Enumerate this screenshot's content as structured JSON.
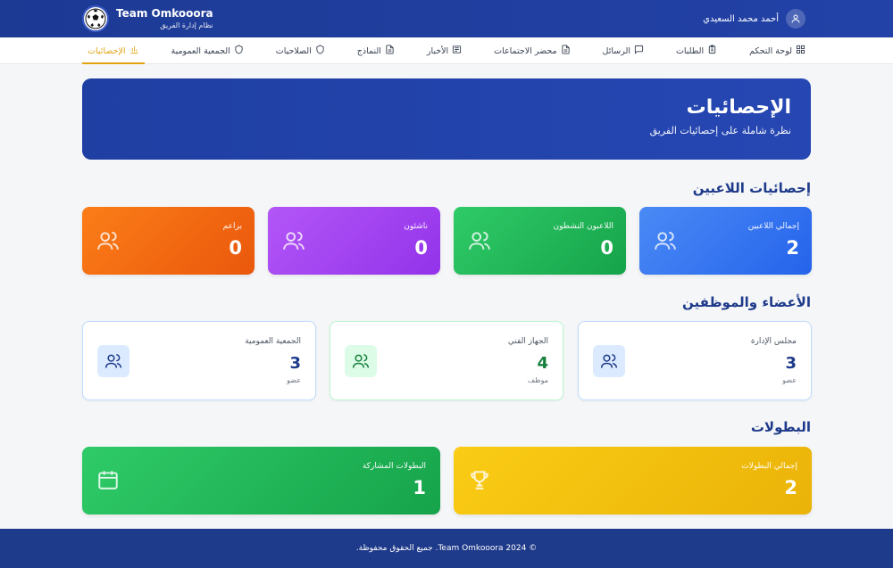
{
  "header": {
    "brand_name": "Team Omkooora",
    "brand_subtitle": "نظام إدارة الفريق",
    "user_name": "أحمد محمد السعيدي"
  },
  "nav": {
    "items": [
      {
        "label": "لوحة التحكم",
        "icon": "grid-icon"
      },
      {
        "label": "الطلبات",
        "icon": "clipboard-icon"
      },
      {
        "label": "الرسائل",
        "icon": "message-icon"
      },
      {
        "label": "محضر الاجتماعات",
        "icon": "document-icon"
      },
      {
        "label": "الأخبار",
        "icon": "newspaper-icon"
      },
      {
        "label": "النماذج",
        "icon": "document-icon"
      },
      {
        "label": "الصلاحيات",
        "icon": "shield-icon"
      },
      {
        "label": "الجمعية العمومية",
        "icon": "shield-icon"
      },
      {
        "label": "الإحصائيات",
        "icon": "bar-chart-icon",
        "active": true
      }
    ]
  },
  "hero": {
    "title": "الإحصائيات",
    "subtitle": "نظرة شاملة على إحصائيات الفريق"
  },
  "players": {
    "title": "إحصائيات اللاعبين",
    "cards": [
      {
        "label": "إجمالي اللاعبين",
        "value": "2",
        "color": "#2563eb"
      },
      {
        "label": "اللاعبون النشطون",
        "value": "0",
        "color": "#16a34a"
      },
      {
        "label": "ناشئون",
        "value": "0",
        "color": "#9333ea"
      },
      {
        "label": "براعم",
        "value": "0",
        "color": "#ea580c"
      }
    ]
  },
  "members": {
    "title": "الأعضاء والموظفين",
    "cards": [
      {
        "label": "مجلس الإدارة",
        "value": "3",
        "unit": "عضو",
        "color": "#1e3a8a"
      },
      {
        "label": "الجهاز الفني",
        "value": "4",
        "unit": "موظف",
        "color": "#15803d"
      },
      {
        "label": "الجمعية العمومية",
        "value": "3",
        "unit": "عضو",
        "color": "#1e3a8a"
      }
    ]
  },
  "tournaments": {
    "title": "البطولات",
    "cards": [
      {
        "label": "إجمالي البطولات",
        "value": "2",
        "icon": "trophy-icon",
        "color": "#eab308"
      },
      {
        "label": "البطولات المشاركة",
        "value": "1",
        "icon": "calendar-icon",
        "color": "#16a34a"
      }
    ]
  },
  "footer": {
    "text": "© Team Omkooora 2024. جميع الحقوق محفوظة."
  }
}
